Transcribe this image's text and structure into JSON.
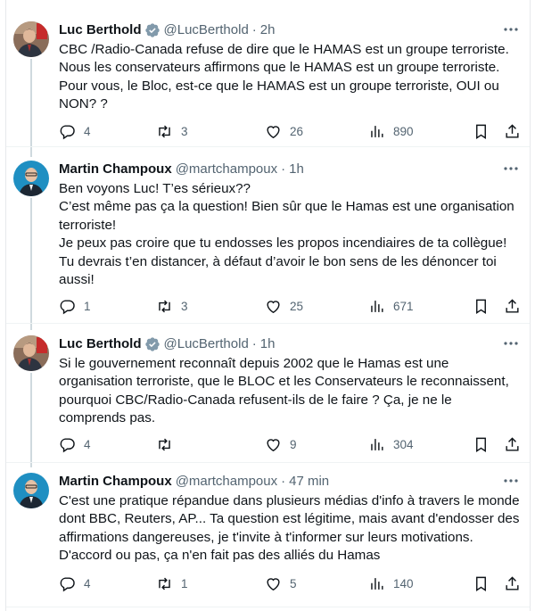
{
  "tweets": [
    {
      "author": "Luc Berthold",
      "verified": true,
      "handle": "@LucBerthold",
      "time": "2h",
      "body": [
        "CBC /Radio-Canada refuse de dire que le HAMAS est un groupe terroriste. Nous les conservateurs affirmons que le HAMAS est un groupe terroriste. Pour vous, le Bloc, est-ce que le HAMAS est un groupe terroriste, OUI ou NON? ?"
      ],
      "replies": "4",
      "retweets": "3",
      "likes": "26",
      "views": "890"
    },
    {
      "author": "Martin Champoux",
      "verified": false,
      "handle": "@martchampoux",
      "time": "1h",
      "body": [
        "Ben voyons Luc! T’es sérieux??",
        "C’est même pas ça la question! Bien sûr que le Hamas est une organisation terroriste!",
        "Je peux pas croire que tu endosses les propos incendiaires de ta collègue! Tu devrais t’en distancer, à défaut d’avoir le bon sens de les dénoncer toi aussi!"
      ],
      "replies": "1",
      "retweets": "3",
      "likes": "25",
      "views": "671"
    },
    {
      "author": "Luc Berthold",
      "verified": true,
      "handle": "@LucBerthold",
      "time": "1h",
      "body": [
        "Si le gouvernement reconnaît depuis 2002 que le Hamas est une organisation terroriste, que le BLOC et les Conservateurs le reconnaissent, pourquoi CBC/Radio-Canada refusent-ils de le faire ? Ça, je ne le comprends pas."
      ],
      "replies": "4",
      "retweets": "",
      "likes": "9",
      "views": "304"
    },
    {
      "author": "Martin Champoux",
      "verified": false,
      "handle": "@martchampoux",
      "time": "47 min",
      "body": [
        "C'est une pratique répandue dans plusieurs médias d'info à travers le monde dont BBC, Reuters, AP... Ta question est légitime, mais avant d'endosser des affirmations dangereuses, je t'invite à t'informer sur leurs motivations. D'accord ou pas, ça n'en fait pas des alliés du Hamas"
      ],
      "replies": "4",
      "retweets": "1",
      "likes": "5",
      "views": "140"
    }
  ],
  "colors": {
    "text": "#0f1419",
    "muted": "#536471",
    "verified_badge": "#829aab",
    "thread_line": "#cfd9de"
  },
  "icons": [
    "verified-badge-icon",
    "more-icon",
    "reply-icon",
    "retweet-icon",
    "like-icon",
    "views-icon",
    "bookmark-icon",
    "share-icon"
  ]
}
